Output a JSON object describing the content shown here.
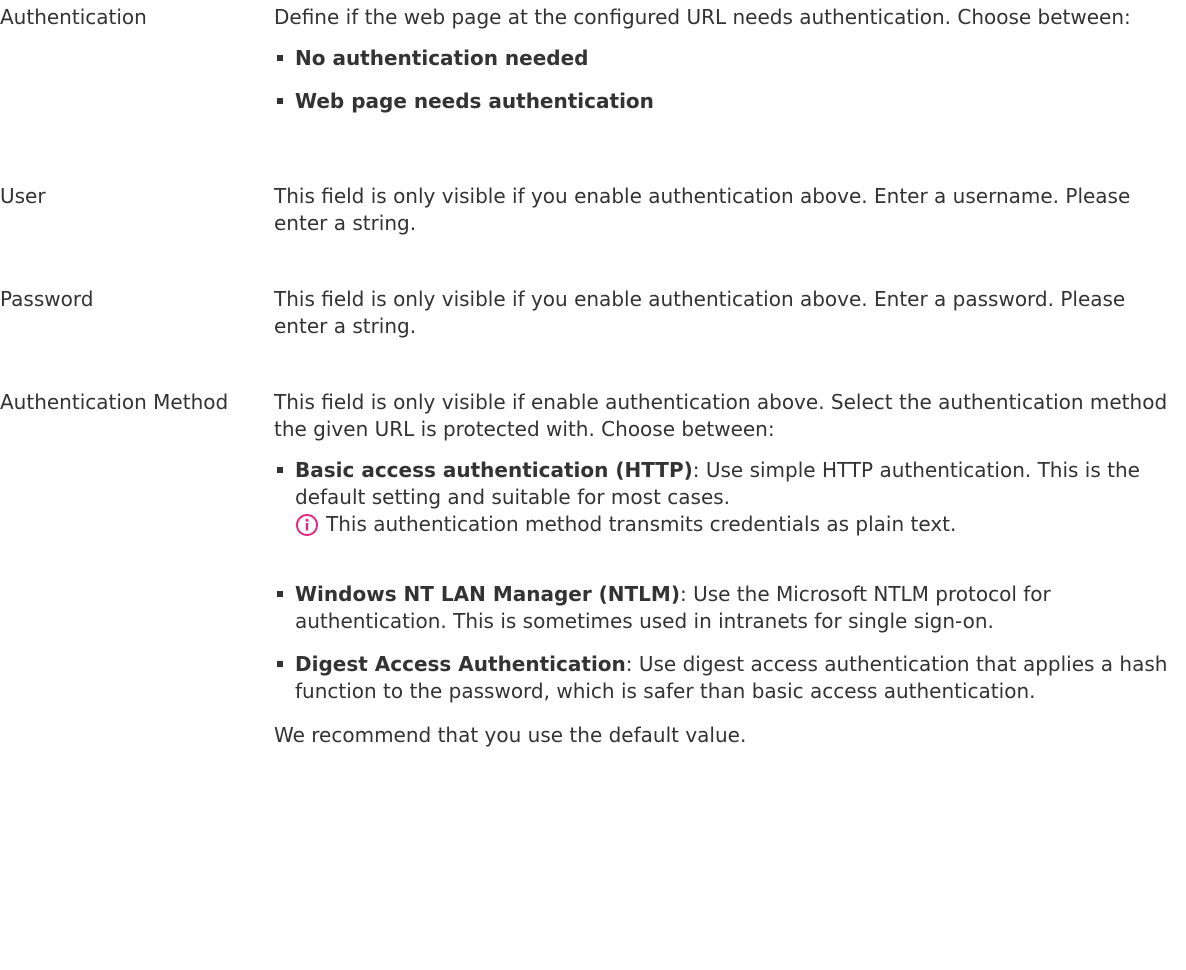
{
  "colors": {
    "text": "#333333",
    "note_icon": "#e4247d",
    "background": "#ffffff"
  },
  "rows": [
    {
      "label": "Authentication",
      "text": "Define if the web page at the configured URL needs authentication. Choose between:",
      "options": [
        {
          "bold": "No authentication needed"
        },
        {
          "bold": "Web page needs authentication"
        }
      ]
    },
    {
      "label": "User",
      "text": "This field is only visible if you enable authentication above. Enter a username. Please enter a string."
    },
    {
      "label": "Password",
      "text": "This field is only visible if you enable authentication above. Enter a password. Please enter a string."
    },
    {
      "label": "Authentication Method",
      "text": "This field is only visible if enable authentication above. Select the authentication method the given URL is protected with. Choose between:",
      "options": [
        {
          "bold": "Basic access authentication (HTTP)",
          "rest": ": Use simple HTTP authentication. This is the default setting and suitable for most cases.",
          "note_icon": "info-icon",
          "note": "This authentication method transmits credentials as plain text."
        },
        {
          "bold": "Windows NT LAN Manager (NTLM)",
          "rest": ": Use the Microsoft NTLM protocol for authentication. This is sometimes used in intranets for single sign-on."
        },
        {
          "bold": "Digest Access Authentication",
          "rest": ": Use digest access authentication that applies a hash function to the password, which is safer than basic access authentication."
        }
      ],
      "footer": "We recommend that you use the default value."
    }
  ]
}
